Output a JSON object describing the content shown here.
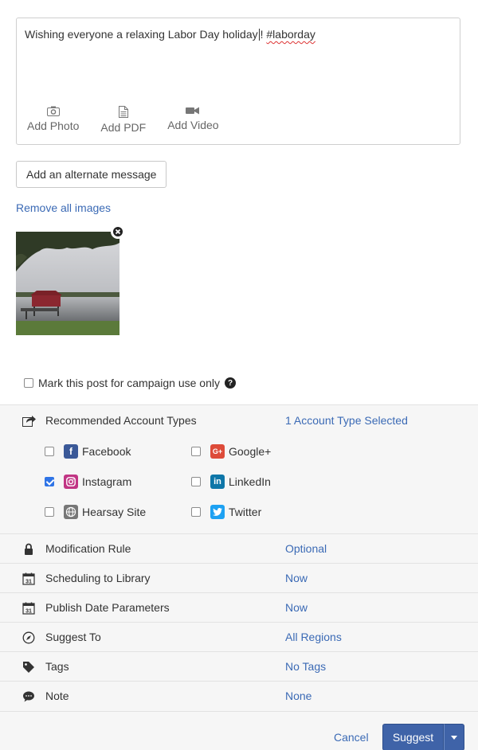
{
  "composer": {
    "text_before_caret": "Wishing everyone a relaxing Labor Day holiday",
    "text_after_caret": "! ",
    "hashtag": "#laborday",
    "attachments": [
      {
        "label": "Add Photo",
        "icon": "camera-icon"
      },
      {
        "label": "Add PDF",
        "icon": "document-icon"
      },
      {
        "label": "Add Video",
        "icon": "video-camera-icon"
      }
    ]
  },
  "alt_message_label": "Add an alternate message",
  "remove_images_label": "Remove all images",
  "campaign": {
    "label": "Mark this post for campaign use only",
    "checked": false
  },
  "recommended": {
    "title": "Recommended Account Types",
    "value": "1 Account Type Selected",
    "accounts": [
      {
        "name": "Facebook",
        "checked": false,
        "color": "#3b5998"
      },
      {
        "name": "Google+",
        "checked": false,
        "color": "#dd4b39"
      },
      {
        "name": "Instagram",
        "checked": true,
        "color": "#c13584"
      },
      {
        "name": "LinkedIn",
        "checked": false,
        "color": "#0e76a8"
      },
      {
        "name": "Hearsay Site",
        "checked": false,
        "color": "#777777"
      },
      {
        "name": "Twitter",
        "checked": false,
        "color": "#1da1f2"
      }
    ]
  },
  "settings": [
    {
      "label": "Modification Rule",
      "value": "Optional",
      "icon": "lock-icon"
    },
    {
      "label": "Scheduling to Library",
      "value": "Now",
      "icon": "calendar-icon"
    },
    {
      "label": "Publish Date Parameters",
      "value": "Now",
      "icon": "calendar-icon"
    },
    {
      "label": "Suggest To",
      "value": "All Regions",
      "icon": "compass-icon"
    },
    {
      "label": "Tags",
      "value": "No Tags",
      "icon": "tag-icon"
    },
    {
      "label": "Note",
      "value": "None",
      "icon": "speech-bubble-icon"
    }
  ],
  "calendar_day": "31",
  "footer": {
    "cancel_label": "Cancel",
    "suggest_label": "Suggest"
  },
  "colors": {
    "link": "#3b6ab5",
    "primary_button": "#3f63a8",
    "checkbox_checked": "#2f74e6"
  }
}
